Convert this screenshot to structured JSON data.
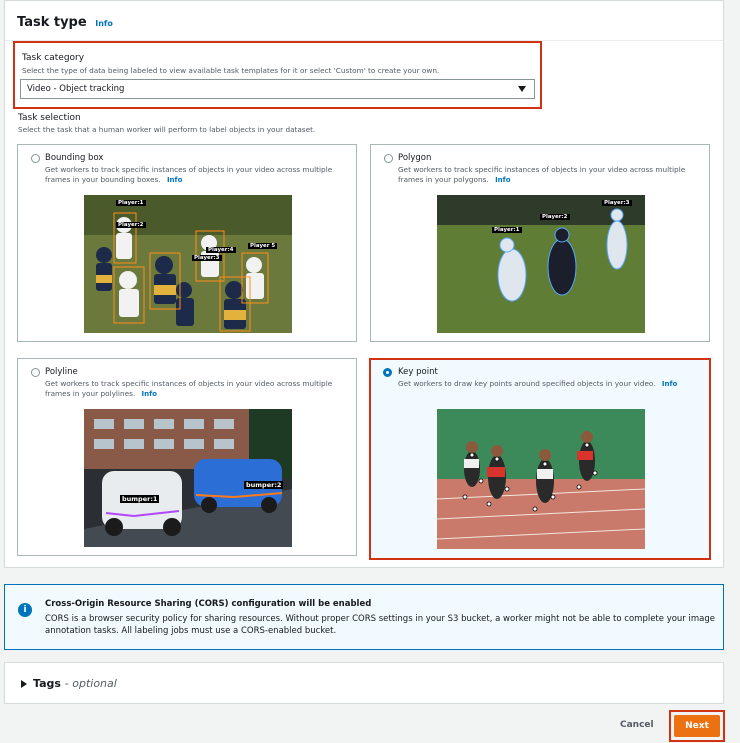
{
  "panel": {
    "title": "Task type",
    "info": "Info"
  },
  "category": {
    "label": "Task category",
    "description": "Select the type of data being labeled to view available task templates for it or select 'Custom' to create your own.",
    "value": "Video - Object tracking"
  },
  "selection": {
    "label": "Task selection",
    "description": "Select the task that a human worker will perform to label objects in your dataset."
  },
  "cards": [
    {
      "title": "Bounding box",
      "description": "Get workers to track specific instances of objects in your video across multiple frames in your bounding boxes.",
      "info": "Info",
      "selected": false,
      "tags": [
        "Player:1",
        "Player:2",
        "Player:3",
        "Player:4",
        "Player 5"
      ]
    },
    {
      "title": "Polygon",
      "description": "Get workers to track specific instances of objects in your video across multiple frames in your polygons.",
      "info": "Info",
      "selected": false,
      "tags": [
        "Player:1",
        "Player:2",
        "Player:3"
      ]
    },
    {
      "title": "Polyline",
      "description": "Get workers to track specific instances of objects in your video across multiple frames in your polylines.",
      "info": "Info",
      "selected": false,
      "tags": [
        "bumper:1",
        "bumper:2"
      ]
    },
    {
      "title": "Key point",
      "description": "Get workers to draw key points around specified objects in your video.",
      "info": "Info",
      "selected": true
    }
  ],
  "alert": {
    "title": "Cross-Origin Resource Sharing (CORS) configuration will be enabled",
    "body": "CORS is a browser security policy for sharing resources. Without proper CORS settings in your S3 bucket, a worker might not be able to complete your image annotation tasks. All labeling jobs must use a CORS-enabled bucket.",
    "icon": "i"
  },
  "tags_section": {
    "title": "Tags",
    "optional": "- optional"
  },
  "footer": {
    "cancel": "Cancel",
    "next": "Next"
  },
  "colors": {
    "accent": "#0073bb",
    "primary_button": "#ec7211",
    "highlight": "#d13212"
  }
}
